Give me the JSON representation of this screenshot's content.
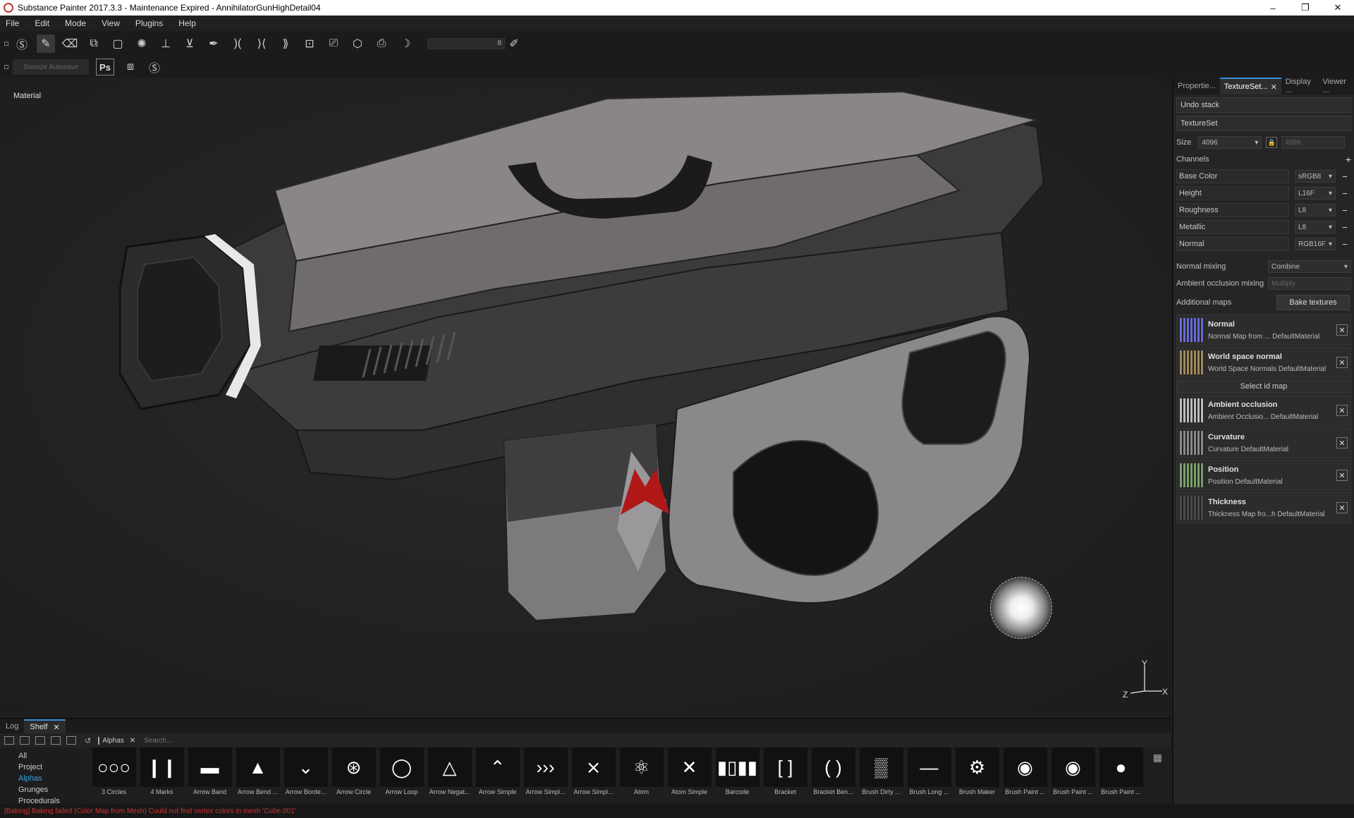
{
  "window": {
    "title": "Substance Painter 2017.3.3 - Maintenance Expired - AnnihilatorGunHighDetail04",
    "controls": [
      "–",
      "❐",
      "✕"
    ]
  },
  "menu": [
    "File",
    "Edit",
    "Mode",
    "View",
    "Plugins",
    "Help"
  ],
  "toolbar": {
    "brush_size_value": "8",
    "snooze_label": "Snooze Autosave",
    "ps_label": "Ps"
  },
  "viewport": {
    "label": "Material",
    "gizmo": {
      "y": "Y",
      "z": "Z",
      "x": "X"
    }
  },
  "right_panel": {
    "tabs": [
      {
        "label": "Propertie..."
      },
      {
        "label": "TextureSet..."
      },
      {
        "label": "Display ..."
      },
      {
        "label": "Viewer ..."
      }
    ],
    "undo_stack": "Undo stack",
    "texture_set": "TextureSet",
    "size_label": "Size",
    "size_value": "4096",
    "size_value2": "4096",
    "channels_label": "Channels",
    "channels": [
      {
        "name": "Base Color",
        "format": "sRGB8"
      },
      {
        "name": "Height",
        "format": "L16F"
      },
      {
        "name": "Roughness",
        "format": "L8"
      },
      {
        "name": "Metallic",
        "format": "L8"
      },
      {
        "name": "Normal",
        "format": "RGB16F"
      }
    ],
    "normal_mixing_label": "Normal mixing",
    "normal_mixing_value": "Combine",
    "ao_mixing_label": "Ambient occlusion mixing",
    "ao_mixing_value": "Multiply",
    "additional_maps_label": "Additional maps",
    "bake_textures": "Bake textures",
    "maps_a": [
      {
        "title": "Normal",
        "subtitle": "Normal Map from ... DefaultMaterial",
        "color": "#6a6ad8"
      },
      {
        "title": "World space normal",
        "subtitle": "World Space Normals DefaultMaterial",
        "color": "#a08a5a"
      }
    ],
    "select_id_map": "Select id map",
    "maps_b": [
      {
        "title": "Ambient occlusion",
        "subtitle": "Ambient Occlusio... DefaultMaterial",
        "color": "#bbbbbb"
      },
      {
        "title": "Curvature",
        "subtitle": "Curvature DefaultMaterial",
        "color": "#888888"
      },
      {
        "title": "Position",
        "subtitle": "Position DefaultMaterial",
        "color": "#7aa06a"
      },
      {
        "title": "Thickness",
        "subtitle": "Thickness Map fro...h DefaultMaterial",
        "color": "#4a4a4a"
      }
    ]
  },
  "shelf": {
    "tabs": [
      "Log",
      "Shelf"
    ],
    "filter_chip": "Alphas",
    "search_placeholder": "Search...",
    "categories": [
      "All",
      "Project",
      "Alphas",
      "Grunges",
      "Procedurals"
    ],
    "selected_category": "Alphas",
    "items": [
      {
        "label": "3 Circles",
        "glyph": "○○○"
      },
      {
        "label": "4 Marks",
        "glyph": "❘❙❙❘"
      },
      {
        "label": "Arrow Band",
        "glyph": "▬"
      },
      {
        "label": "Arrow Bend ...",
        "glyph": "▲"
      },
      {
        "label": "Arrow Borde...",
        "glyph": "⌄"
      },
      {
        "label": "Arrow Circle",
        "glyph": "⊛"
      },
      {
        "label": "Arrow Loop",
        "glyph": "◯"
      },
      {
        "label": "Arrow Negat...",
        "glyph": "△"
      },
      {
        "label": "Arrow Simple",
        "glyph": "⌃"
      },
      {
        "label": "Arrow Simpl...",
        "glyph": "›››"
      },
      {
        "label": "Arrow Simpl...",
        "glyph": "⨯"
      },
      {
        "label": "Atom",
        "glyph": "⚛"
      },
      {
        "label": "Atom Simple",
        "glyph": "✕"
      },
      {
        "label": "Barcode",
        "glyph": "▮▯▮▮"
      },
      {
        "label": "Bracket",
        "glyph": "[ ]"
      },
      {
        "label": "Bracket Ben...",
        "glyph": "( )"
      },
      {
        "label": "Brush Dirty ...",
        "glyph": "▒"
      },
      {
        "label": "Brush Long ...",
        "glyph": "—"
      },
      {
        "label": "Brush Maker",
        "glyph": "⚙"
      },
      {
        "label": "Brush Paint ...",
        "glyph": "◉"
      },
      {
        "label": "Brush Paint ...",
        "glyph": "◉"
      },
      {
        "label": "Brush Paint ...",
        "glyph": "●"
      }
    ]
  },
  "status": "[Baking] Baking failed (Color Map from Mesh) Could not find vertex colors in mesh 'Cube.001'"
}
